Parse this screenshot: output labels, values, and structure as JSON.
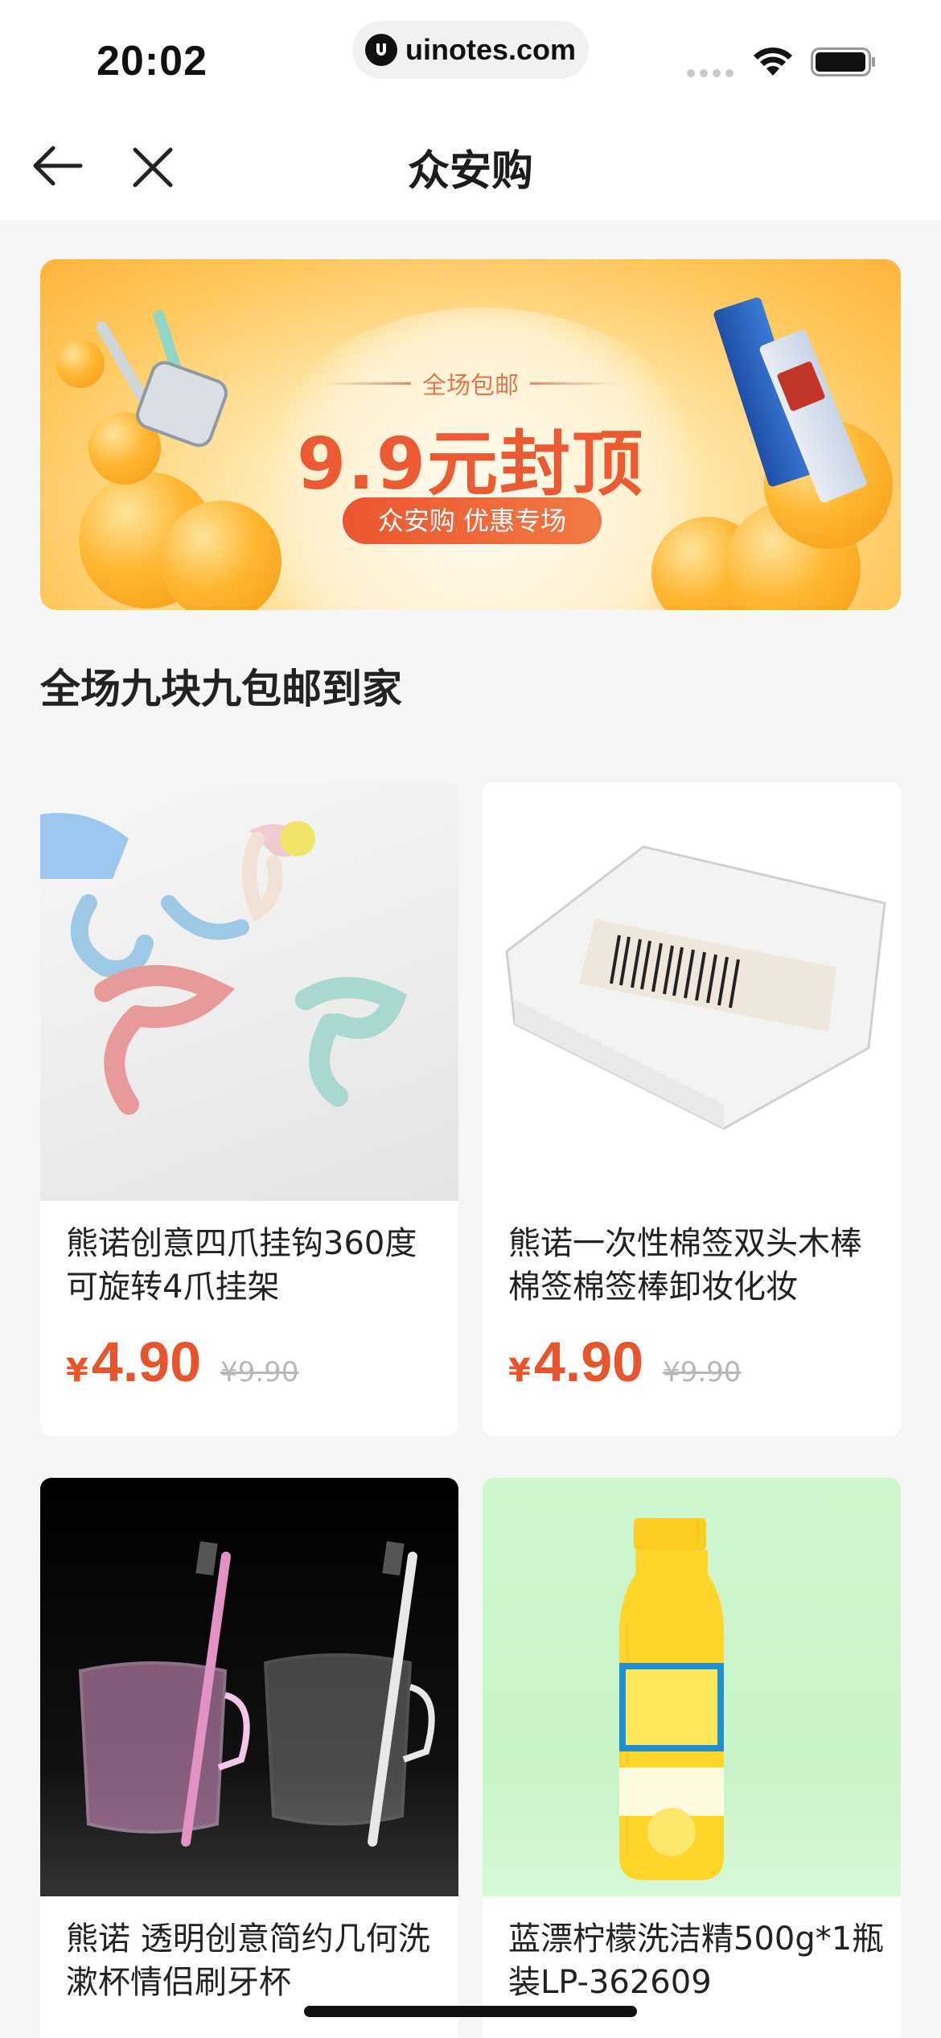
{
  "status_bar": {
    "time": "20:02",
    "url": "uinotes.com"
  },
  "nav": {
    "title": "众安购",
    "back_icon": "arrow-left-icon",
    "close_icon": "close-icon"
  },
  "banner": {
    "subtitle": "全场包邮",
    "headline": "9.9元封顶",
    "tag": "众安购 优惠专场"
  },
  "section": {
    "title": "全场九块九包邮到家"
  },
  "products": [
    {
      "name": "熊诺创意四爪挂钩360度可旋转4爪挂架",
      "currency": "¥",
      "price": "4.90",
      "original_price": "¥9.90"
    },
    {
      "name": "熊诺一次性棉签双头木棒棉签棉签棒卸妆化妆",
      "currency": "¥",
      "price": "4.90",
      "original_price": "¥9.90"
    },
    {
      "name": "熊诺 透明创意简约几何洗漱杯情侣刷牙杯",
      "currency": "¥",
      "price": "",
      "original_price": ""
    },
    {
      "name": "蓝漂柠檬洗洁精500g*1瓶装LP-362609",
      "currency": "¥",
      "price": "",
      "original_price": ""
    }
  ],
  "colors": {
    "accent": "#e8542c",
    "banner_bg": "#ffc75c",
    "page_bg": "#f6f6f6"
  }
}
